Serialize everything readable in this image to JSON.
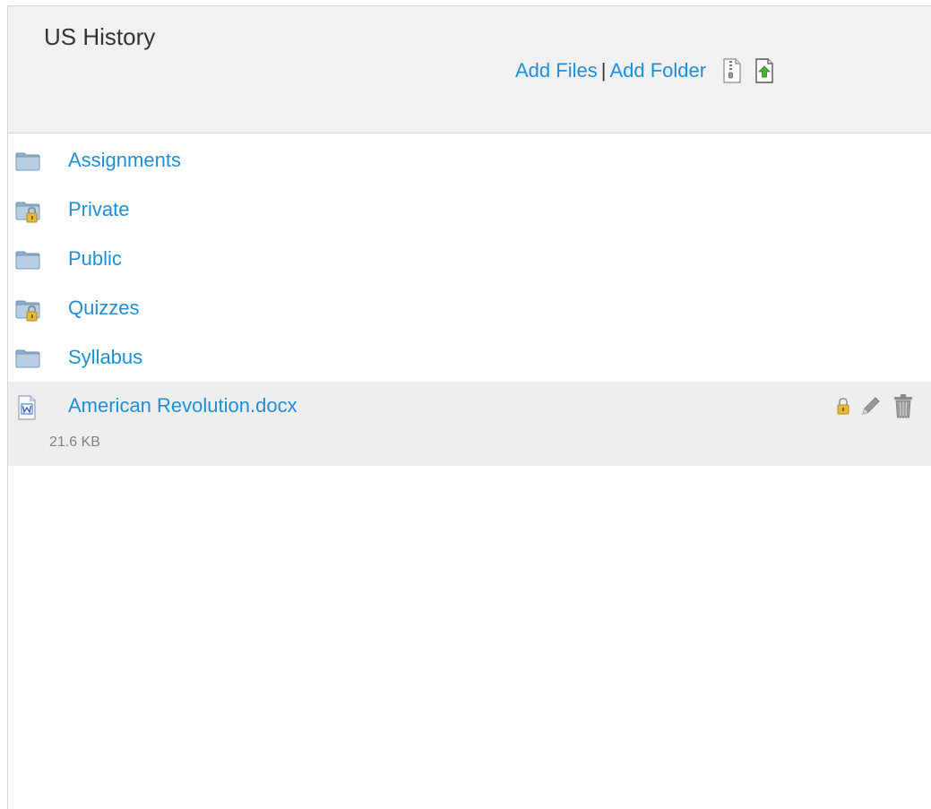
{
  "header": {
    "title": "US History",
    "add_files_label": "Add Files",
    "separator": "|",
    "add_folder_label": "Add Folder",
    "icons": [
      "zip-download-icon",
      "upload-document-icon"
    ]
  },
  "folders": [
    {
      "label": "Assignments",
      "icon": "folder-icon",
      "locked": false
    },
    {
      "label": "Private",
      "icon": "locked-folder-icon",
      "locked": true
    },
    {
      "label": "Public",
      "icon": "folder-icon",
      "locked": false
    },
    {
      "label": "Quizzes",
      "icon": "locked-folder-icon",
      "locked": true
    },
    {
      "label": "Syllabus",
      "icon": "folder-icon",
      "locked": false
    }
  ],
  "files": [
    {
      "label": "American Revolution.docx",
      "size": "21.6 KB",
      "icon": "word-document-icon",
      "actions": [
        "lock-icon",
        "edit-pencil-icon",
        "trash-icon"
      ]
    }
  ],
  "colors": {
    "link": "#1e8fd6",
    "header_bg": "#f1f1f1",
    "selected_row_bg": "#eeeeee",
    "folder_blue": "#a9c2d8",
    "lock_gold": "#e0b33a"
  }
}
